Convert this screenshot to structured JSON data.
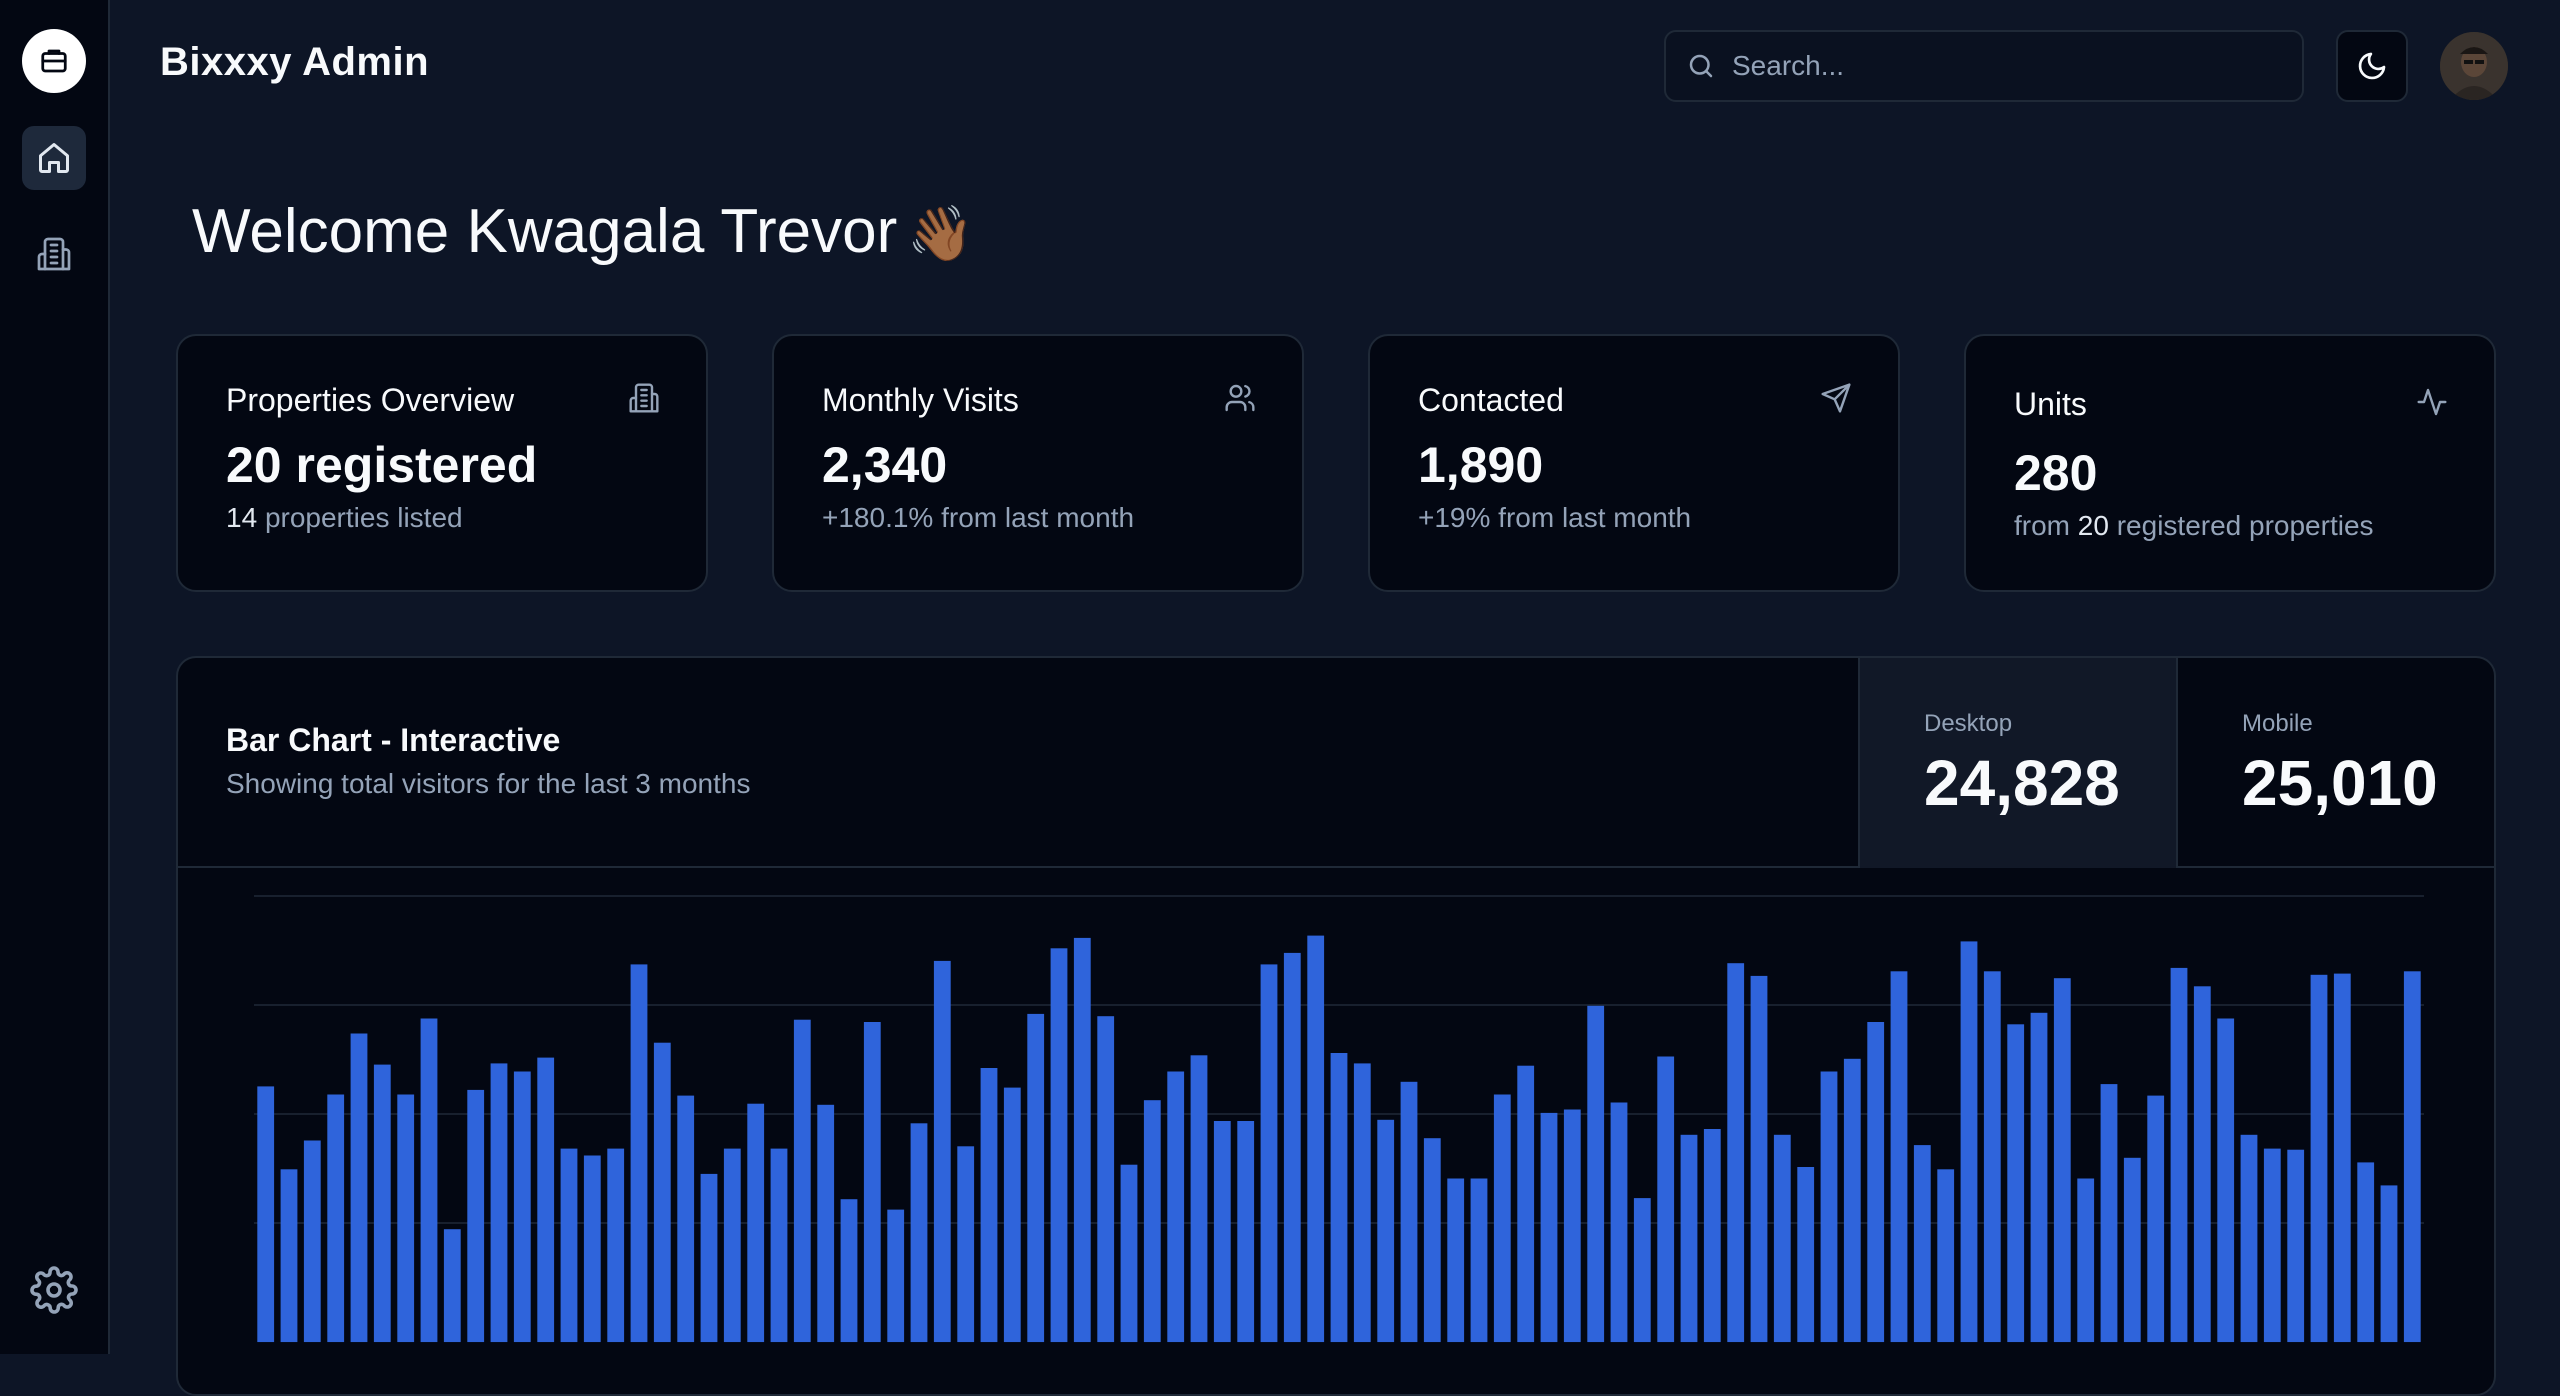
{
  "app": {
    "title": "Bixxxy Admin"
  },
  "sidebar": {
    "items": [
      {
        "name": "home",
        "icon": "home-icon",
        "active": true
      },
      {
        "name": "properties",
        "icon": "building-icon",
        "active": false
      }
    ],
    "settings_icon": "gear-icon"
  },
  "search": {
    "placeholder": "Search..."
  },
  "header": {
    "welcome": "Welcome Kwagala Trevor",
    "wave": "👋🏾"
  },
  "cards": [
    {
      "title": "Properties Overview",
      "value": "20 registered",
      "sub_strong": "14",
      "sub_rest": "properties listed",
      "icon": "building-icon"
    },
    {
      "title": "Monthly Visits",
      "value": "2,340",
      "sub": "+180.1% from last month",
      "icon": "users-icon"
    },
    {
      "title": "Contacted",
      "value": "1,890",
      "sub": "+19% from last month",
      "icon": "send-icon"
    },
    {
      "title": "Units",
      "value": "280",
      "sub_pre": "from",
      "sub_strong": "20",
      "sub_rest": "registered properties",
      "icon": "activity-icon"
    }
  ],
  "chart": {
    "title": "Bar Chart - Interactive",
    "subtitle": "Showing total visitors for the last 3 months",
    "stats": [
      {
        "label": "Desktop",
        "value": "24,828",
        "active": true
      },
      {
        "label": "Mobile",
        "value": "25,010",
        "active": false
      }
    ],
    "bar_color": "#2f64db"
  },
  "chart_data": {
    "type": "bar",
    "series": [
      {
        "values": [
          222,
          150,
          175,
          215,
          268,
          241,
          215,
          281,
          98,
          219,
          242,
          235,
          247,
          168,
          162,
          168,
          328,
          260,
          214,
          146,
          168,
          207,
          168,
          280,
          206,
          124,
          278,
          115,
          190,
          331,
          170,
          238,
          221,
          285,
          342,
          351,
          283,
          154,
          210,
          235,
          249,
          192,
          192,
          328,
          338,
          353,
          251,
          242,
          193,
          226,
          177,
          142,
          142,
          215,
          240,
          199,
          202,
          292,
          208,
          125,
          248,
          180,
          185,
          329,
          318,
          180,
          152,
          235,
          246,
          278,
          322,
          171,
          150,
          348,
          322,
          276,
          286,
          316,
          142,
          224,
          160,
          214,
          325,
          309,
          281,
          180,
          168,
          167,
          319,
          320,
          156,
          136,
          322
        ]
      }
    ],
    "ylim": [
      0,
      410
    ],
    "grid": true
  }
}
